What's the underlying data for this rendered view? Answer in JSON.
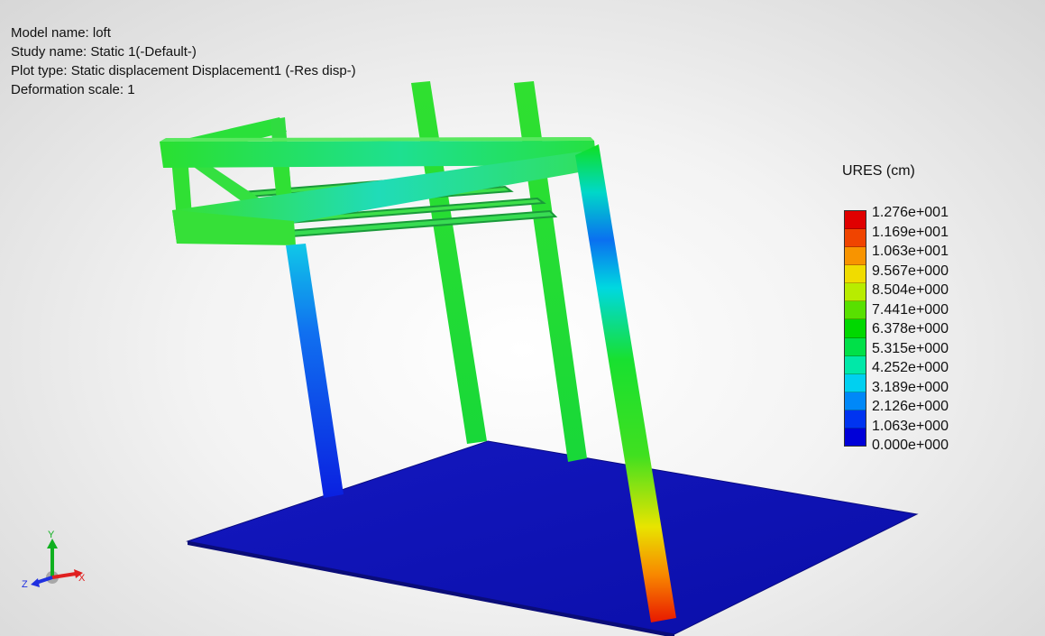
{
  "info": {
    "model_name": "Model name: loft",
    "study_name": "Study name: Static 1(-Default-)",
    "plot_type": "Plot type: Static displacement Displacement1 (-Res disp-)",
    "deformation_scale": "Deformation scale: 1"
  },
  "legend": {
    "title": "URES (cm)",
    "labels": [
      "1.276e+001",
      "1.169e+001",
      "1.063e+001",
      "9.567e+000",
      "8.504e+000",
      "7.441e+000",
      "6.378e+000",
      "5.315e+000",
      "4.252e+000",
      "3.189e+000",
      "2.126e+000",
      "1.063e+000",
      "0.000e+000"
    ],
    "colors": [
      "#e00000",
      "#f04400",
      "#f89400",
      "#f0dc00",
      "#b8ec00",
      "#58e000",
      "#00d800",
      "#00e048",
      "#00e8a8",
      "#00d0f0",
      "#0088f8",
      "#0034f0",
      "#0000d8"
    ]
  },
  "triad": {
    "x_label": "X",
    "y_label": "Y",
    "z_label": "Z",
    "x_color": "#e02020",
    "y_color": "#10b020",
    "z_color": "#2030e0"
  },
  "scene_colors": {
    "base": "#0a10b8",
    "frame": "#22e022"
  }
}
